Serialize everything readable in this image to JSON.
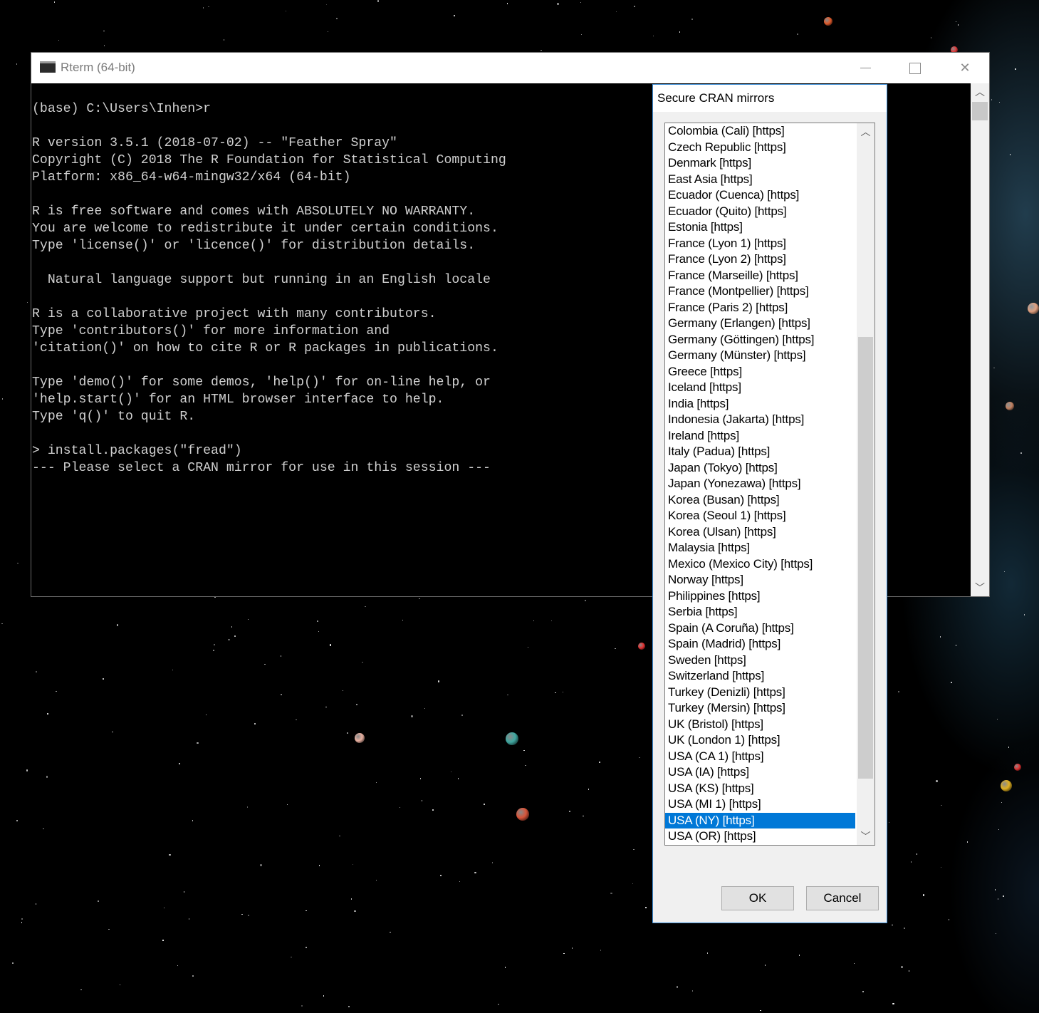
{
  "console": {
    "title": "Rterm (64-bit)",
    "lines": [
      "(base) C:\\Users\\Inhen>r",
      "",
      "R version 3.5.1 (2018-07-02) -- \"Feather Spray\"",
      "Copyright (C) 2018 The R Foundation for Statistical Computing",
      "Platform: x86_64-w64-mingw32/x64 (64-bit)",
      "",
      "R is free software and comes with ABSOLUTELY NO WARRANTY.",
      "You are welcome to redistribute it under certain conditions.",
      "Type 'license()' or 'licence()' for distribution details.",
      "",
      "  Natural language support but running in an English locale",
      "",
      "R is a collaborative project with many contributors.",
      "Type 'contributors()' for more information and",
      "'citation()' on how to cite R or R packages in publications.",
      "",
      "Type 'demo()' for some demos, 'help()' for on-line help, or",
      "'help.start()' for an HTML browser interface to help.",
      "Type 'q()' to quit R.",
      "",
      "> install.packages(\"fread\")",
      "--- Please select a CRAN mirror for use in this session ---"
    ],
    "window_buttons": {
      "minimize": "minimize",
      "maximize": "maximize",
      "close": "✕"
    }
  },
  "dialog": {
    "title": "Secure CRAN mirrors",
    "selected_mirror": "USA (NY) [https]",
    "mirrors": [
      "Colombia (Cali) [https]",
      "Czech Republic [https]",
      "Denmark [https]",
      "East Asia [https]",
      "Ecuador (Cuenca) [https]",
      "Ecuador (Quito) [https]",
      "Estonia [https]",
      "France (Lyon 1) [https]",
      "France (Lyon 2) [https]",
      "France (Marseille) [https]",
      "France (Montpellier) [https]",
      "France (Paris 2) [https]",
      "Germany (Erlangen) [https]",
      "Germany (Göttingen) [https]",
      "Germany (Münster) [https]",
      "Greece [https]",
      "Iceland [https]",
      "India [https]",
      "Indonesia (Jakarta) [https]",
      "Ireland [https]",
      "Italy (Padua) [https]",
      "Japan (Tokyo) [https]",
      "Japan (Yonezawa) [https]",
      "Korea (Busan) [https]",
      "Korea (Seoul 1) [https]",
      "Korea (Ulsan) [https]",
      "Malaysia [https]",
      "Mexico (Mexico City) [https]",
      "Norway [https]",
      "Philippines [https]",
      "Serbia [https]",
      "Spain (A Coruña) [https]",
      "Spain (Madrid) [https]",
      "Sweden [https]",
      "Switzerland [https]",
      "Turkey (Denizli) [https]",
      "Turkey (Mersin) [https]",
      "UK (Bristol) [https]",
      "UK (London 1) [https]",
      "USA (CA 1) [https]",
      "USA (IA) [https]",
      "USA (KS) [https]",
      "USA (MI 1) [https]",
      "USA (NY) [https]",
      "USA (OR) [https]"
    ],
    "ok_label": "OK",
    "cancel_label": "Cancel"
  },
  "colors": {
    "selection": "#0078d7",
    "dialog_border": "#3d8ed6",
    "console_text": "#d0d0d0"
  }
}
